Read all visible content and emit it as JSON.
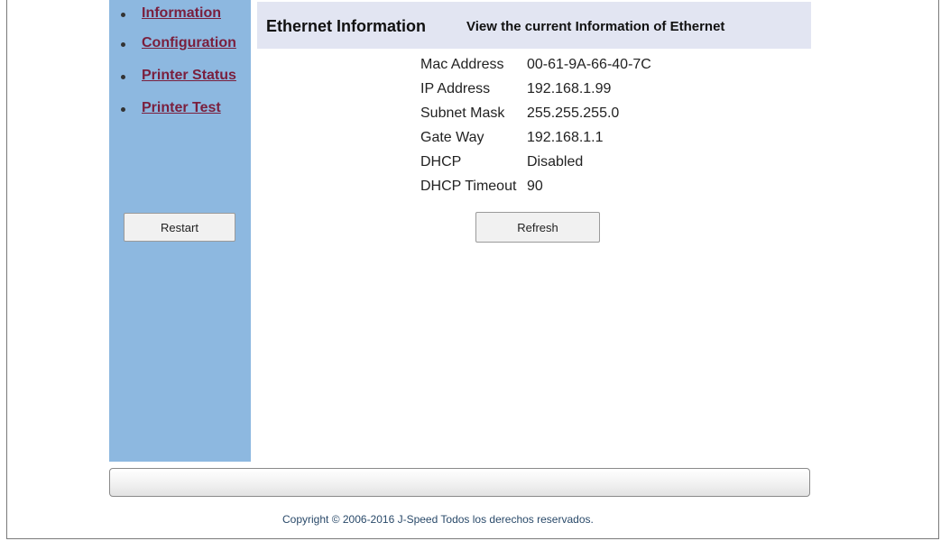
{
  "nav": {
    "items": [
      {
        "label": "Information"
      },
      {
        "label": "Configuration"
      },
      {
        "label": "Printer Status"
      },
      {
        "label": "Printer Test"
      }
    ],
    "restart_label": "Restart"
  },
  "header": {
    "title": "Ethernet Information",
    "subtitle": "View the current Information of Ethernet"
  },
  "info": {
    "rows": [
      {
        "label": "Mac Address",
        "value": "00-61-9A-66-40-7C"
      },
      {
        "label": "IP Address",
        "value": "192.168.1.99"
      },
      {
        "label": "Subnet Mask",
        "value": "255.255.255.0"
      },
      {
        "label": "Gate Way",
        "value": "192.168.1.1"
      },
      {
        "label": "DHCP",
        "value": "Disabled"
      },
      {
        "label": "DHCP Timeout",
        "value": "90"
      }
    ]
  },
  "actions": {
    "refresh_label": "Refresh"
  },
  "footer": {
    "copyright": "Copyright © 2006-2016 J-Speed Todos los derechos reservados."
  }
}
